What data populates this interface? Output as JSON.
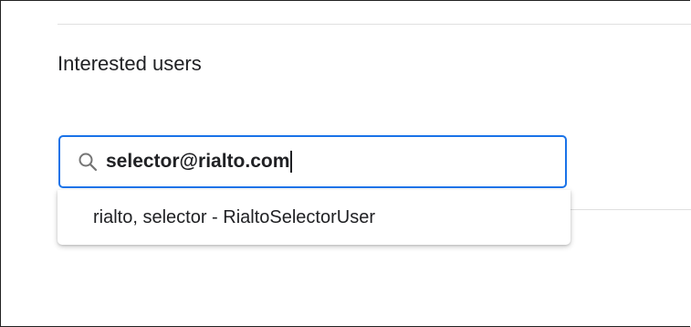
{
  "section": {
    "title": "Interested users"
  },
  "search": {
    "value": "selector@rialto.com",
    "icon": "search-icon"
  },
  "suggestions": [
    {
      "label": "rialto, selector - RialtoSelectorUser"
    }
  ],
  "colors": {
    "focus_border": "#1a73e8",
    "divider": "#e0e0e0",
    "text": "#202124"
  }
}
